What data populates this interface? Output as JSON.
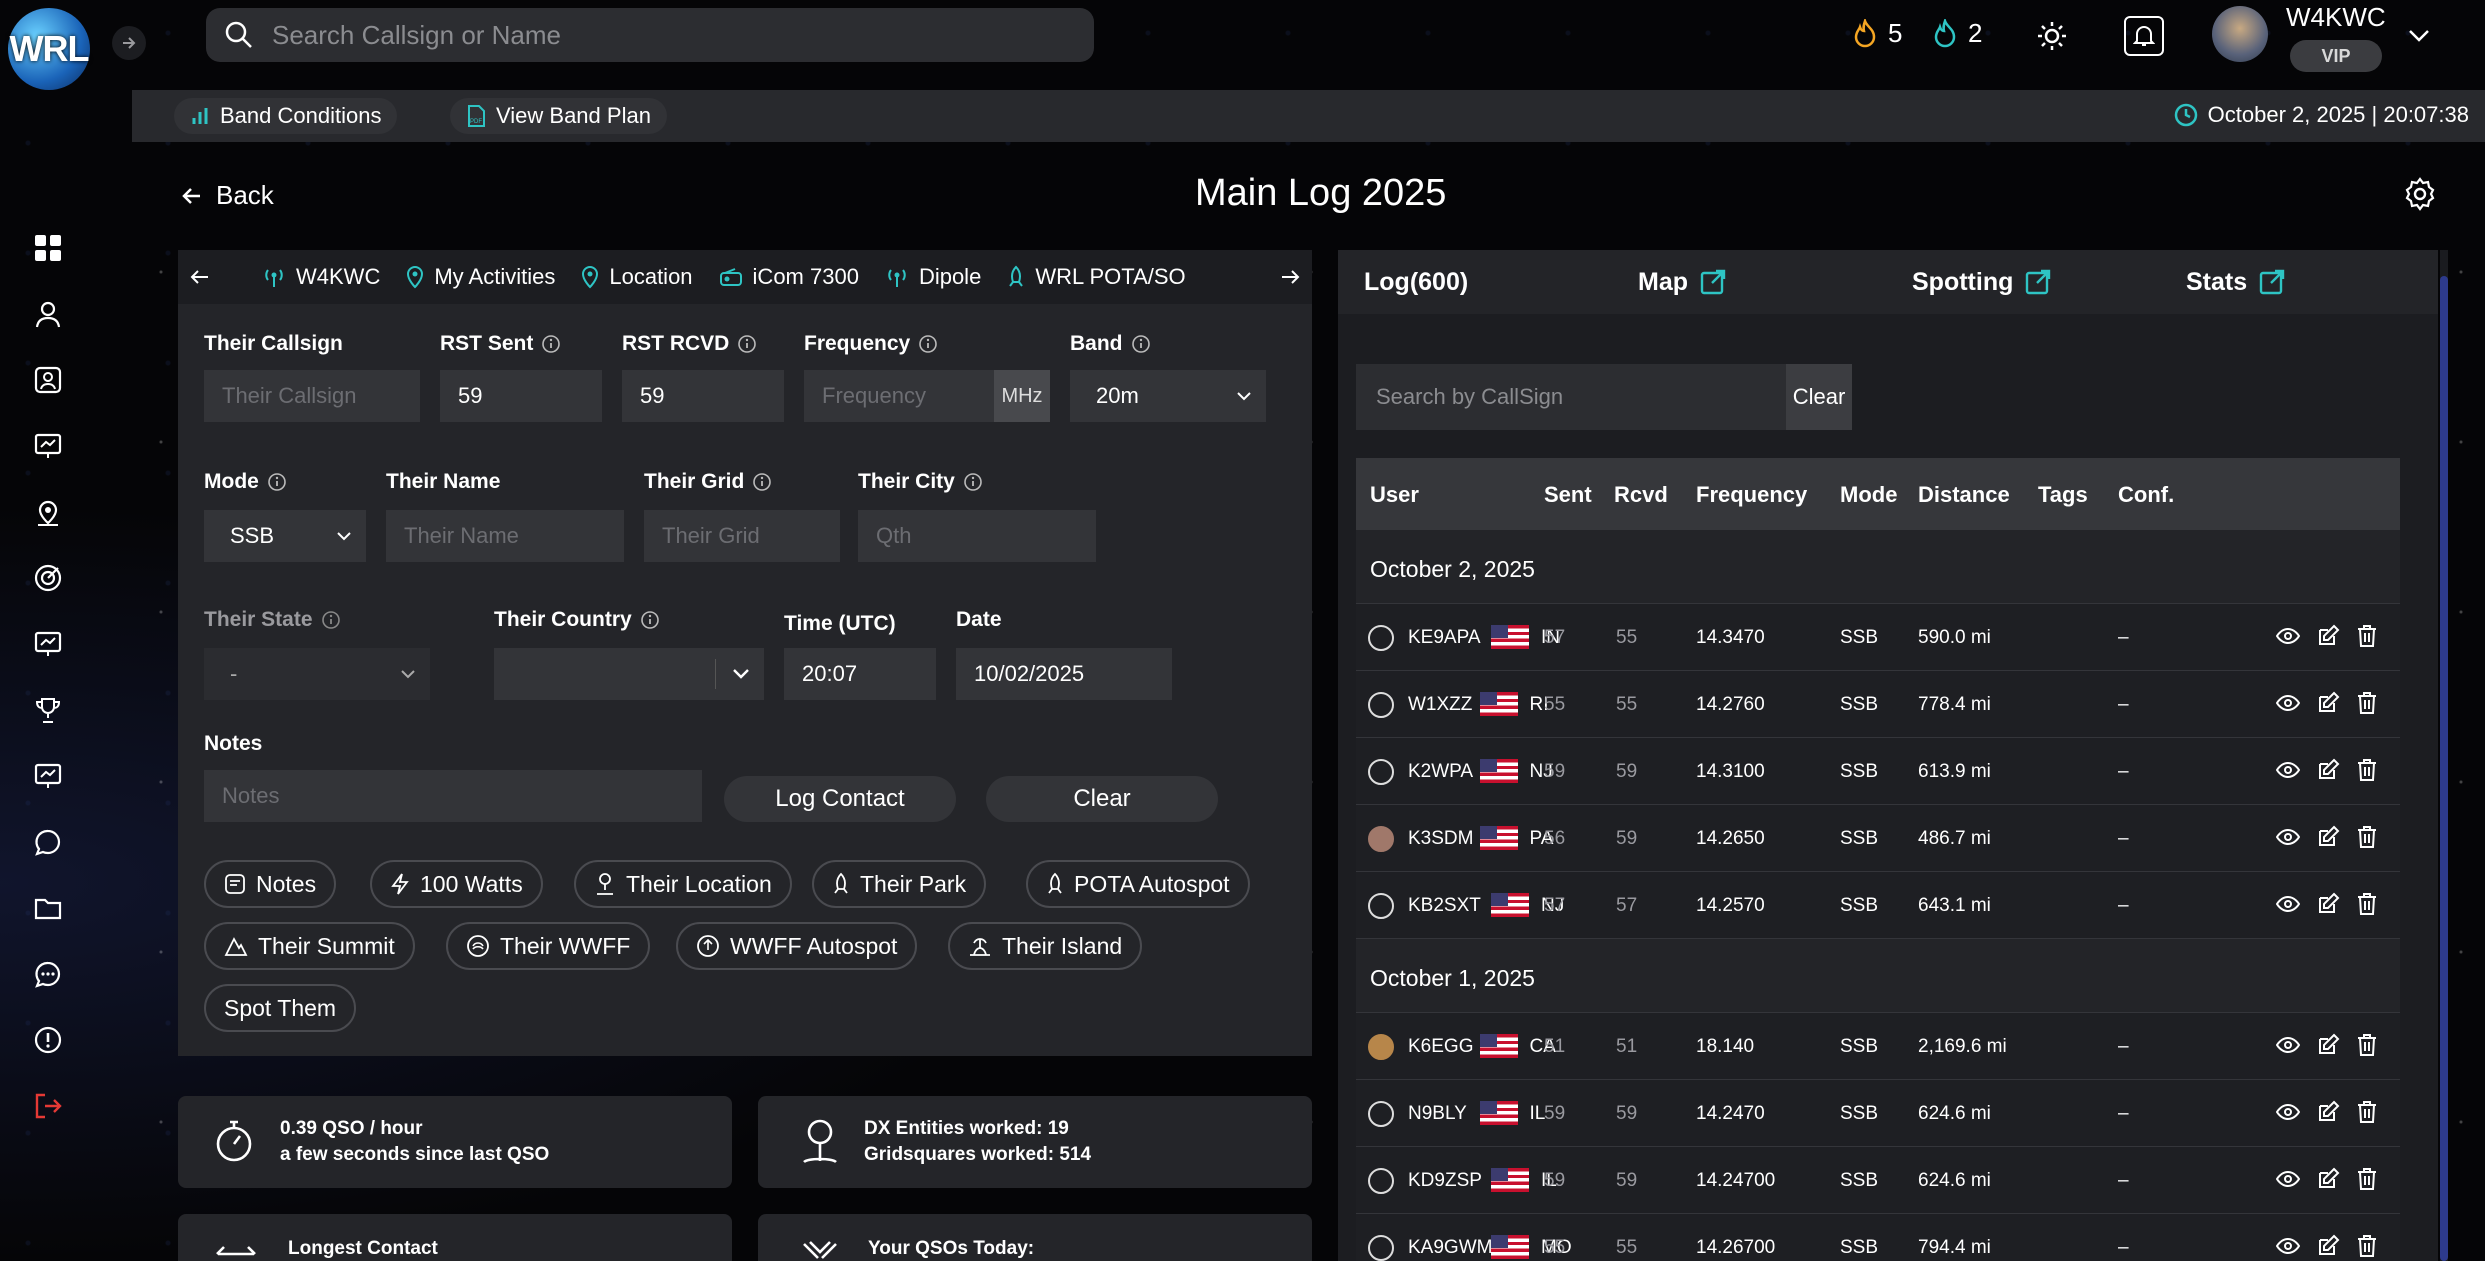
{
  "app": {
    "logo_text": "WRL",
    "accent": "#2ec4c4",
    "brand_blue": "#1a63b8"
  },
  "search": {
    "placeholder": "Search Callsign or Name"
  },
  "topbar": {
    "streak1_count": "5",
    "streak2_count": "2",
    "username": "W4KWC",
    "badge": "VIP"
  },
  "subbar": {
    "band_conditions": "Band Conditions",
    "view_band_plan": "View Band Plan",
    "datetime": "October 2, 2025 | 20:07:38"
  },
  "header": {
    "back": "Back",
    "title": "Main Log 2025"
  },
  "log_tabs": [
    "W4KWC",
    "My Activities",
    "Location",
    "iCom 7300",
    "Dipole",
    "WRL POTA/SO"
  ],
  "form": {
    "their_callsign": {
      "label": "Their Callsign",
      "placeholder": "Their Callsign",
      "value": ""
    },
    "rst_sent": {
      "label": "RST Sent",
      "value": "59"
    },
    "rst_rcvd": {
      "label": "RST RCVD",
      "value": "59"
    },
    "frequency": {
      "label": "Frequency",
      "placeholder": "Frequency",
      "unit": "MHz"
    },
    "band": {
      "label": "Band",
      "value": "20m"
    },
    "mode": {
      "label": "Mode",
      "value": "SSB"
    },
    "their_name": {
      "label": "Their Name",
      "placeholder": "Their Name"
    },
    "their_grid": {
      "label": "Their Grid",
      "placeholder": "Their Grid"
    },
    "their_city": {
      "label": "Their City",
      "placeholder": "Qth"
    },
    "their_state": {
      "label": "Their State",
      "value": "-"
    },
    "their_country": {
      "label": "Their Country",
      "value": ""
    },
    "time": {
      "label": "Time (UTC)",
      "value": "20:07"
    },
    "date": {
      "label": "Date",
      "value": "10/02/2025"
    },
    "notes": {
      "label": "Notes",
      "placeholder": "Notes"
    },
    "log_contact": "Log Contact",
    "clear": "Clear"
  },
  "chips": [
    "Notes",
    "100 Watts",
    "Their Location",
    "Their Park",
    "POTA Autospot",
    "Their Summit",
    "Their WWFF",
    "WWFF Autospot",
    "Their Island",
    "Spot Them"
  ],
  "stats": {
    "rate_line1": "0.39 QSO / hour",
    "rate_line2": "a few seconds since last QSO",
    "dx_line1": "DX Entities worked: 19",
    "dx_line2": "Gridsquares worked: 514",
    "longest": "Longest Contact",
    "today": "Your QSOs Today:"
  },
  "right": {
    "tabs": {
      "log": "Log(600)",
      "map": "Map",
      "spotting": "Spotting",
      "stats": "Stats"
    },
    "search_placeholder": "Search by CallSign",
    "clear": "Clear",
    "columns": [
      "User",
      "Sent",
      "Rcvd",
      "Frequency",
      "Mode",
      "Distance",
      "Tags",
      "Conf."
    ],
    "groups": [
      {
        "date": "October 2, 2025",
        "rows": [
          {
            "call": "KE9APA",
            "state": "IN",
            "sent": "57",
            "rcvd": "55",
            "freq": "14.3470",
            "mode": "SSB",
            "dist": "590.0 mi",
            "conf": "–"
          },
          {
            "call": "W1XZZ",
            "state": "RI",
            "sent": "55",
            "rcvd": "55",
            "freq": "14.2760",
            "mode": "SSB",
            "dist": "778.4 mi",
            "conf": "–"
          },
          {
            "call": "K2WPA",
            "state": "NJ",
            "sent": "59",
            "rcvd": "59",
            "freq": "14.3100",
            "mode": "SSB",
            "dist": "613.9 mi",
            "conf": "–"
          },
          {
            "call": "K3SDM",
            "state": "PA",
            "sent": "56",
            "rcvd": "59",
            "freq": "14.2650",
            "mode": "SSB",
            "dist": "486.7 mi",
            "conf": "–"
          },
          {
            "call": "KB2SXT",
            "state": "NJ",
            "sent": "57",
            "rcvd": "57",
            "freq": "14.2570",
            "mode": "SSB",
            "dist": "643.1 mi",
            "conf": "–"
          }
        ]
      },
      {
        "date": "October 1, 2025",
        "rows": [
          {
            "call": "K6EGG",
            "state": "CA",
            "sent": "51",
            "rcvd": "51",
            "freq": "18.140",
            "mode": "SSB",
            "dist": "2,169.6 mi",
            "conf": "–"
          },
          {
            "call": "N9BLY",
            "state": "IL",
            "sent": "59",
            "rcvd": "59",
            "freq": "14.2470",
            "mode": "SSB",
            "dist": "624.6 mi",
            "conf": "–"
          },
          {
            "call": "KD9ZSP",
            "state": "IL",
            "sent": "59",
            "rcvd": "59",
            "freq": "14.24700",
            "mode": "SSB",
            "dist": "624.6 mi",
            "conf": "–"
          },
          {
            "call": "KA9GWM",
            "state": "MO",
            "sent": "55",
            "rcvd": "55",
            "freq": "14.26700",
            "mode": "SSB",
            "dist": "794.4 mi",
            "conf": "–"
          }
        ]
      }
    ]
  }
}
